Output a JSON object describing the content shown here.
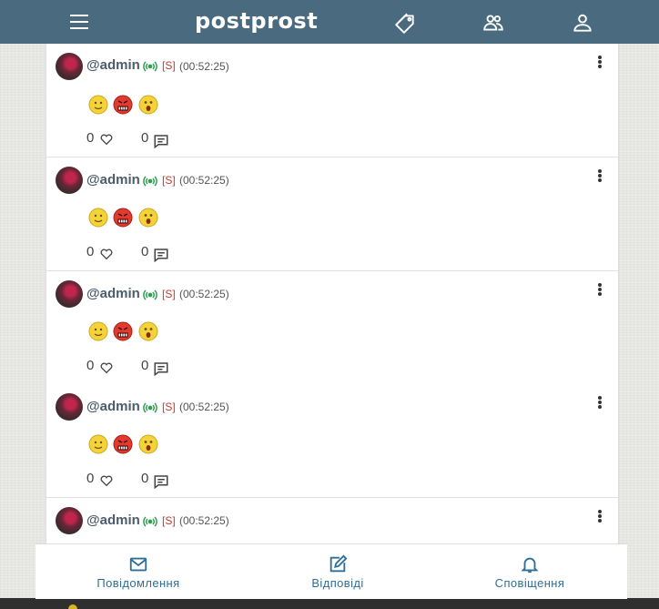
{
  "app": {
    "logo": "postprost"
  },
  "header": {
    "menu_icon": "hamburger-menu-icon",
    "icons": [
      "tags-icon",
      "people-icon",
      "profile-icon"
    ]
  },
  "posts": [
    {
      "author": "@admin",
      "tag": "[S]",
      "time": "(00:52:25)",
      "emojis": [
        "smile",
        "angry",
        "surprised"
      ],
      "likes": "0",
      "comments": "0"
    },
    {
      "author": "@admin",
      "tag": "[S]",
      "time": "(00:52:25)",
      "emojis": [
        "smile",
        "angry",
        "surprised"
      ],
      "likes": "0",
      "comments": "0"
    },
    {
      "author": "@admin",
      "tag": "[S]",
      "time": "(00:52:25)",
      "emojis": [
        "smile",
        "angry",
        "surprised"
      ],
      "likes": "0",
      "comments": "0"
    },
    {
      "author": "@admin",
      "tag": "[S]",
      "time": "(00:52:25)",
      "emojis": [
        "smile",
        "angry",
        "surprised"
      ],
      "likes": "0",
      "comments": "0"
    },
    {
      "author": "@admin",
      "tag": "[S]",
      "time": "(00:52:25)",
      "emojis": [],
      "likes": "",
      "comments": ""
    }
  ],
  "bottom_nav": [
    {
      "label": "Повідомлення",
      "icon": "mail-icon"
    },
    {
      "label": "Відповіді",
      "icon": "edit-note-icon"
    },
    {
      "label": "Сповіщення",
      "icon": "bell-icon"
    }
  ],
  "colors": {
    "topbar": "#4a6a80",
    "accent": "#2f6f97",
    "tag": "#c0392b",
    "live": "#2e9e4f"
  }
}
